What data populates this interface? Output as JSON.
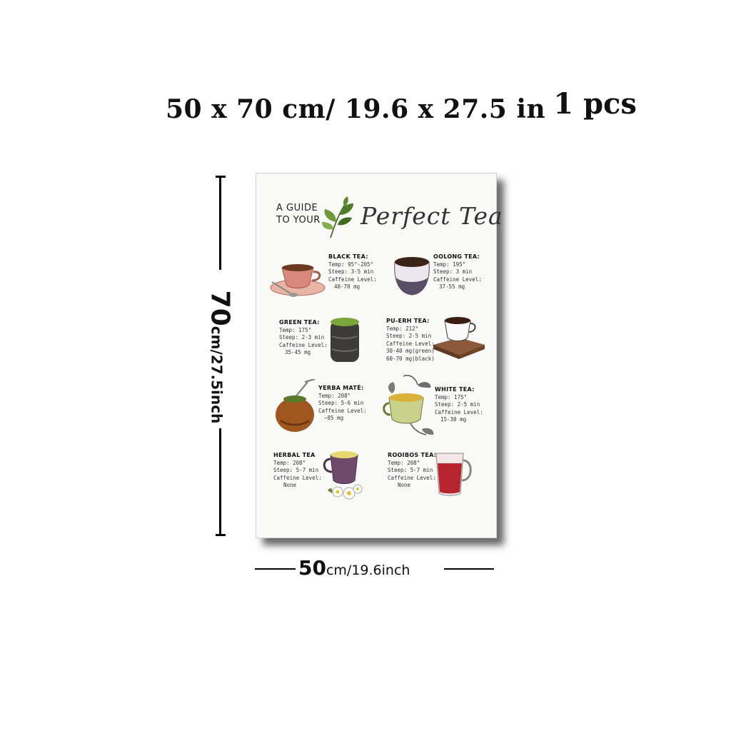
{
  "headline": {
    "size": "50 x 70 cm/ 19.6 x 27.5 in",
    "quantity": "1 pcs"
  },
  "dimension_height": {
    "value": "70",
    "unit": "cm/27.5inch"
  },
  "dimension_width": {
    "value": "50",
    "unit": "cm/19.6inch"
  },
  "poster": {
    "title_line1": "A GUIDE",
    "title_line2": "TO YOUR",
    "title_script": "Perfect Tea",
    "teas": [
      {
        "name": "BLACK TEA:",
        "temp": "Temp: 95°-205°",
        "steep": "Steep: 3-5 min",
        "caffeine_label": "Caffeine Level:",
        "caffeine": "40-70 mg",
        "color": "#c4766a"
      },
      {
        "name": "OOLONG TEA:",
        "temp": "Temp: 195°",
        "steep": "Steep: 3 min",
        "caffeine_label": "Caffeine Level:",
        "caffeine": "37-55 mg",
        "color": "#5a4d66"
      },
      {
        "name": "GREEN TEA:",
        "temp": "Temp: 175°",
        "steep": "Steep: 2-3 min",
        "caffeine_label": "Caffeine Level:",
        "caffeine": "35-45 mg",
        "color": "#6b8a3a"
      },
      {
        "name": "PU-ERH TEA:",
        "temp": "Temp: 212°",
        "steep": "Steep: 2-5 min",
        "caffeine_label": "Caffeine Level:",
        "caffeine": "30-40 mg(green)",
        "caffeine2": "60-70 mg(black)",
        "color": "#4a2f1f"
      },
      {
        "name": "YERBA MATÉ:",
        "temp": "Temp: 208°",
        "steep": "Steep: 5-6 min",
        "caffeine_label": "Caffeine Level:",
        "caffeine": "~85 mg",
        "color": "#8a4a1c"
      },
      {
        "name": "WHITE TEA:",
        "temp": "Temp: 175°",
        "steep": "Steep: 2-5 min",
        "caffeine_label": "Caffeine Level:",
        "caffeine": "15-30 mg",
        "color": "#c9a640"
      },
      {
        "name": "HERBAL TEA",
        "temp": "Temp: 208°",
        "steep": "Steep: 5-7 min",
        "caffeine_label": "Caffeine Level:",
        "caffeine": "None",
        "color": "#6f4a6b"
      },
      {
        "name": "ROOIBOS TEA:",
        "temp": "Temp: 208°",
        "steep": "Steep: 5-7 min",
        "caffeine_label": "Caffeine Level:",
        "caffeine": "None",
        "color": "#b8242e"
      }
    ]
  }
}
